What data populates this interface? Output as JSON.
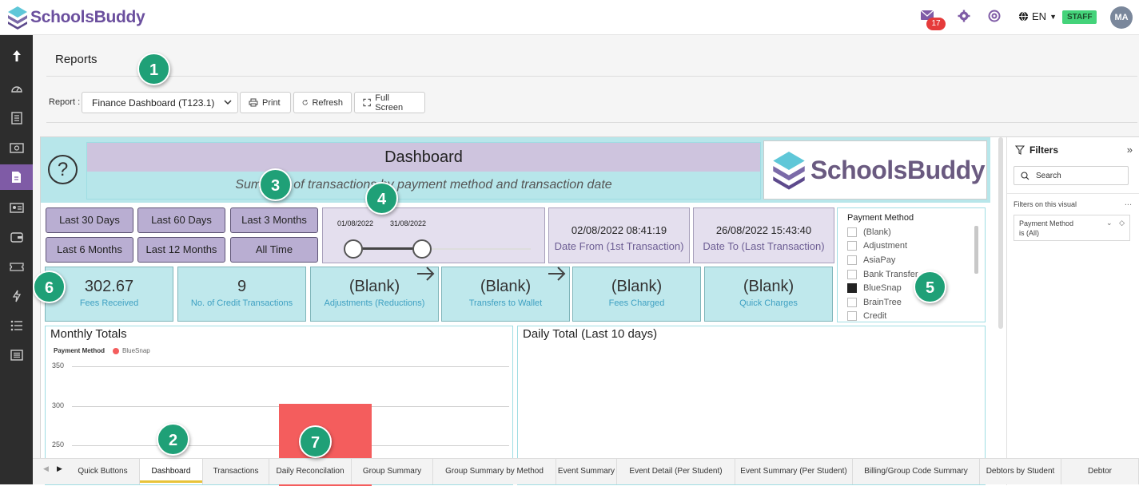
{
  "app": {
    "logo_text": "SchoolsBuddy"
  },
  "topbar": {
    "mail_count": "17",
    "language": "EN",
    "role": "STAFF",
    "avatar_initials": "MA"
  },
  "sidebar": {
    "items": [
      "go-up",
      "dashboard",
      "document",
      "money",
      "report",
      "id-card",
      "wallet",
      "ticket",
      "power",
      "list",
      "news"
    ],
    "active": "report"
  },
  "page": {
    "title": "Reports"
  },
  "toolbar": {
    "report_label": "Report :",
    "report_selected": "Finance Dashboard (T123.1)",
    "print_label": "Print",
    "refresh_label": "Refresh",
    "fullscreen_label": "Full Screen"
  },
  "dashboard": {
    "title": "Dashboard",
    "subtitle": "Summary of transactions by payment method and transaction date",
    "help_symbol": "?",
    "brand_text": "SchoolsBuddy",
    "period_buttons": [
      "Last 30 Days",
      "Last 60 Days",
      "Last 3 Months",
      "Last 6 Months",
      "Last 12 Months",
      "All Time"
    ],
    "slider": {
      "start": "01/08/2022",
      "end": "31/08/2022"
    },
    "date_from": {
      "value": "02/08/2022 08:41:19",
      "label": "Date From (1st Transaction)"
    },
    "date_to": {
      "value": "26/08/2022 15:43:40",
      "label": "Date To (Last Transaction)"
    },
    "payment_method": {
      "title": "Payment Method",
      "options": [
        {
          "label": "(Blank)",
          "checked": false
        },
        {
          "label": "Adjustment",
          "checked": false
        },
        {
          "label": "AsiaPay",
          "checked": false
        },
        {
          "label": "Bank Transfer",
          "checked": false
        },
        {
          "label": "BlueSnap",
          "checked": true
        },
        {
          "label": "BrainTree",
          "checked": false
        },
        {
          "label": "Credit",
          "checked": false
        }
      ]
    },
    "kpis": [
      {
        "value": "302.67",
        "label": "Fees Received"
      },
      {
        "value": "9",
        "label": "No. of Credit Transactions"
      },
      {
        "value": "(Blank)",
        "label": "Adjustments (Reductions)"
      },
      {
        "value": "(Blank)",
        "label": "Transfers to Wallet"
      },
      {
        "value": "(Blank)",
        "label": "Fees Charged"
      },
      {
        "value": "(Blank)",
        "label": "Quick Charges"
      }
    ],
    "monthly_title": "Monthly Totals",
    "daily_title": "Daily Total (Last 10 days)"
  },
  "chart_data": {
    "type": "bar",
    "title": "Monthly Totals",
    "legend_title": "Payment Method",
    "series": [
      {
        "name": "BlueSnap",
        "values": [
          302.67
        ],
        "color": "#f45d5d"
      }
    ],
    "categories": [
      ""
    ],
    "yticks": [
      "350",
      "300",
      "250"
    ],
    "ylim": [
      0,
      350
    ],
    "grid": true
  },
  "filters": {
    "title": "Filters",
    "search_placeholder": "Search",
    "section": "Filters on this visual",
    "more": "...",
    "card_line1": "Payment Method",
    "card_line2": "is (All)"
  },
  "tabs": [
    "Quick Buttons",
    "Dashboard",
    "Transactions",
    "Daily Reconcilation",
    "Group Summary",
    "Group Summary by Method",
    "Event Summary",
    "Event Detail (Per Student)",
    "Event Summary (Per Student)",
    "Billing/Group Code Summary",
    "Debtors by Student",
    "Debtor"
  ],
  "active_tab": "Dashboard",
  "callouts": [
    "1",
    "2",
    "3",
    "4",
    "5",
    "6",
    "7"
  ],
  "colors": {
    "brand": "#6b4f9e",
    "accent_teal": "#b7e6ea",
    "lavender": "#cec4de",
    "bar": "#f45d5d",
    "callout": "#1fa077"
  }
}
